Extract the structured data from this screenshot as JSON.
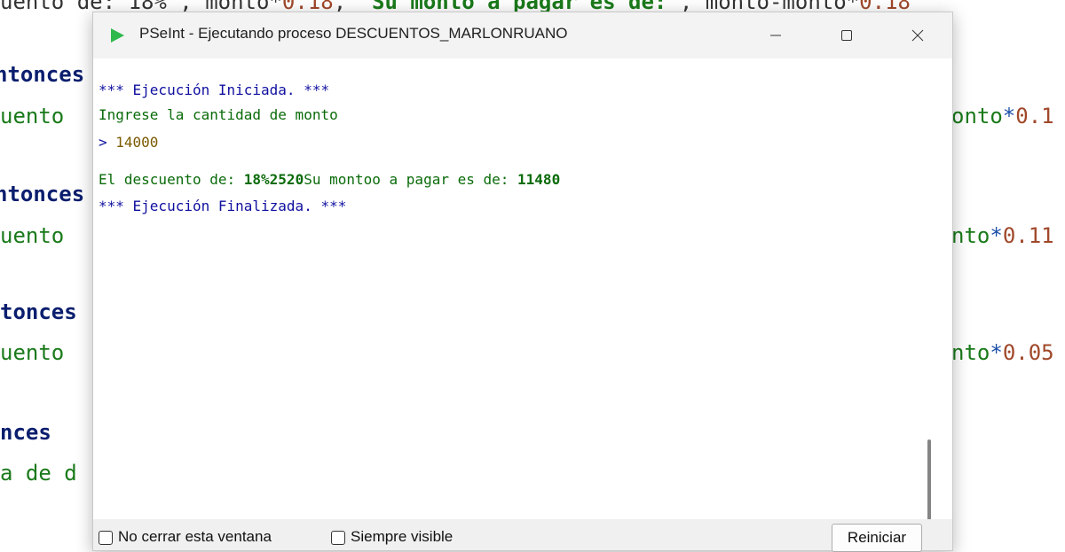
{
  "editor": {
    "top_strip": {
      "p1": "uento de: 18%\", monto*",
      "n1": "0.18",
      "p2": ", \"",
      "s1": "Su monto a pagar es de:",
      "p3": "\", monto-monto*",
      "n2": "0.18"
    },
    "lines": [
      {
        "kw": "ntonces",
        "name": "line-entonces-1"
      },
      {
        "id": "uento",
        "tail_id": "onto",
        "tail_op": "*",
        "tail_num": "0.1"
      },
      {
        "kw": "ntonces"
      },
      {
        "id": "uento",
        "tail_id": "nto",
        "tail_op": "*",
        "tail_num": "0.11"
      },
      {
        "kw": "tonces"
      },
      {
        "id": "uento",
        "tail_id": "nto",
        "tail_op": "*",
        "tail_num": "0.05"
      },
      {
        "kw": "nces"
      },
      {
        "id": "a de d"
      }
    ]
  },
  "window": {
    "title": "PSeInt - Ejecutando proceso DESCUENTOS_MARLONRUANO",
    "console": {
      "line1": "*** Ejecución Iniciada. ***",
      "line2": "Ingrese la cantidad de monto",
      "line3_prompt": "> ",
      "line3_value": "14000",
      "line4_a": "El descuento de: ",
      "line4_b": "18%2520",
      "line4_c": "Su montoo a pagar es de: ",
      "line4_d": "11480",
      "line5": "*** Ejecución Finalizada. ***"
    },
    "bottom": {
      "chk1_label": "No cerrar esta ventana",
      "chk2_label": "Siempre visible",
      "restart_label": "Reiniciar"
    },
    "colors": {
      "app_icon": "#2fb84b",
      "console_blue": "#1010a0",
      "console_green": "#0a6b0a"
    }
  }
}
